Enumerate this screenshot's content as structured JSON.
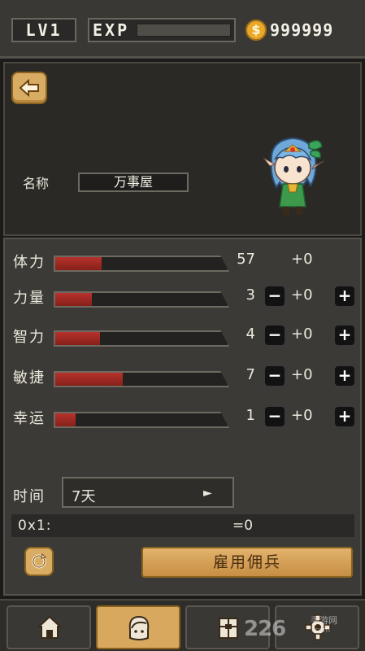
{
  "hud": {
    "level": "LV1",
    "exp_label": "EXP",
    "exp_progress": 0,
    "coins": "999999"
  },
  "character": {
    "name_label": "名称",
    "name_value": "万事屋"
  },
  "stats": [
    {
      "name": "体力",
      "value": "57",
      "bonus": "+0",
      "fill": 0.27,
      "adjustable": false
    },
    {
      "name": "力量",
      "value": "3",
      "bonus": "+0",
      "fill": 0.21,
      "adjustable": true
    },
    {
      "name": "智力",
      "value": "4",
      "bonus": "+0",
      "fill": 0.26,
      "adjustable": true
    },
    {
      "name": "敏捷",
      "value": "7",
      "bonus": "+0",
      "fill": 0.39,
      "adjustable": true
    },
    {
      "name": "幸运",
      "value": "1",
      "bonus": "+0",
      "fill": 0.12,
      "adjustable": true
    }
  ],
  "buttons": {
    "minus": "−",
    "plus": "+"
  },
  "hire": {
    "time_label": "时间",
    "time_value": "7天",
    "time_arrow": "►",
    "formula_left": "0x1:",
    "formula_right": "=0",
    "hire_button": "雇用佣兵"
  },
  "nav": {
    "items": [
      "home",
      "character",
      "inventory",
      "settings"
    ],
    "active": "character"
  },
  "watermark": {
    "number": "226",
    "sub": "手游网",
    "url": ".com"
  },
  "colors": {
    "bar_fill": "#b7322c",
    "accent_gold": "#d9ac63",
    "coin": "#e9a926"
  }
}
